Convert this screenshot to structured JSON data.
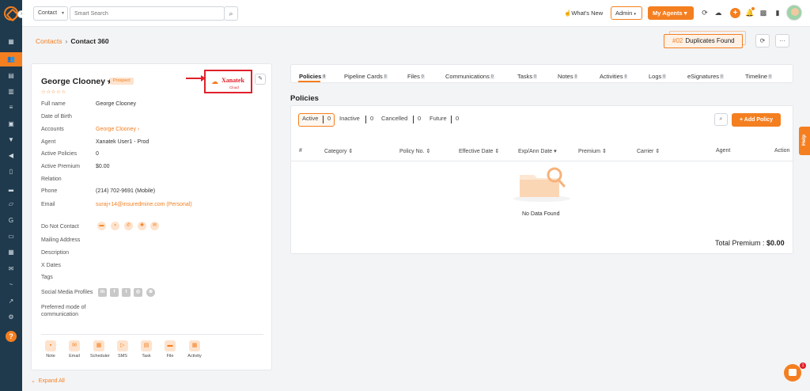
{
  "header": {
    "contact_select": "Contact",
    "search_placeholder": "Smart Search",
    "whats_new": "What's New",
    "admin": "Admin",
    "my_agents": "My Agents",
    "notification_count": ""
  },
  "breadcrumb": {
    "parent": "Contacts",
    "current": "Contact 360"
  },
  "duplicates": {
    "count": "#02",
    "label": "Duplicates Found"
  },
  "contact": {
    "name": "George Clooney",
    "badge": "Prospect",
    "xanatek_brand": "Xanatek",
    "xanatek_sub": "Cloud",
    "fields": [
      {
        "label": "Full name",
        "value": "George Clooney"
      },
      {
        "label": "Date of Birth",
        "value": ""
      },
      {
        "label": "Accounts",
        "value": "George Clooney ›"
      },
      {
        "label": "Agent",
        "value": "Xanatek User1 - Prod"
      },
      {
        "label": "Active Policies",
        "value": "0"
      },
      {
        "label": "Active Premium",
        "value": "$0.00"
      },
      {
        "label": "Relation",
        "value": ""
      },
      {
        "label": "Phone",
        "value": "(214) 702-9691 (Mobile)"
      },
      {
        "label": "Email",
        "value": "suraj+14@insuredmine.com (Personal)"
      }
    ],
    "do_not_contact": "Do Not Contact",
    "mailing_address": "Mailing Address",
    "description": "Description",
    "x_dates": "X Dates",
    "tags": "Tags",
    "social_profiles": "Social Media Profiles",
    "preferred_mode_1": "Preferred mode of",
    "preferred_mode_2": "communication",
    "actions": [
      "Note",
      "Email",
      "Scheduler",
      "SMS",
      "Task",
      "File",
      "Activity"
    ],
    "expand_all": "Expand All"
  },
  "tabs": [
    {
      "label": "Policies",
      "count": "0"
    },
    {
      "label": "Pipeline Cards",
      "count": "0"
    },
    {
      "label": "Files",
      "count": "0"
    },
    {
      "label": "Communications",
      "count": "0"
    },
    {
      "label": "Tasks",
      "count": "0"
    },
    {
      "label": "Notes",
      "count": "0"
    },
    {
      "label": "Activities",
      "count": "0"
    },
    {
      "label": "Logs",
      "count": "0"
    },
    {
      "label": "eSignatures",
      "count": "0"
    },
    {
      "label": "Timeline",
      "count": "0"
    }
  ],
  "policies": {
    "title": "Policies",
    "filters": [
      {
        "label": "Active",
        "count": "0"
      },
      {
        "label": "Inactive",
        "count": "0"
      },
      {
        "label": "Cancelled",
        "count": "0"
      },
      {
        "label": "Future",
        "count": "0"
      }
    ],
    "add_button": "+ Add Policy",
    "columns": [
      "#",
      "Category ⇕",
      "Policy No. ⇕",
      "Effective Date ⇕",
      "Exp/Ann Date ▾",
      "Premium ⇕",
      "Carrier ⇕",
      "Agent",
      "Action"
    ],
    "empty": "No Data Found",
    "total_label": "Total Premium :",
    "total_value": "$0.00"
  },
  "help": "Help",
  "chat_badge": "1",
  "colors": {
    "accent": "#f47f20",
    "sidebar": "#1f3a4d",
    "highlight": "#e0202a"
  }
}
